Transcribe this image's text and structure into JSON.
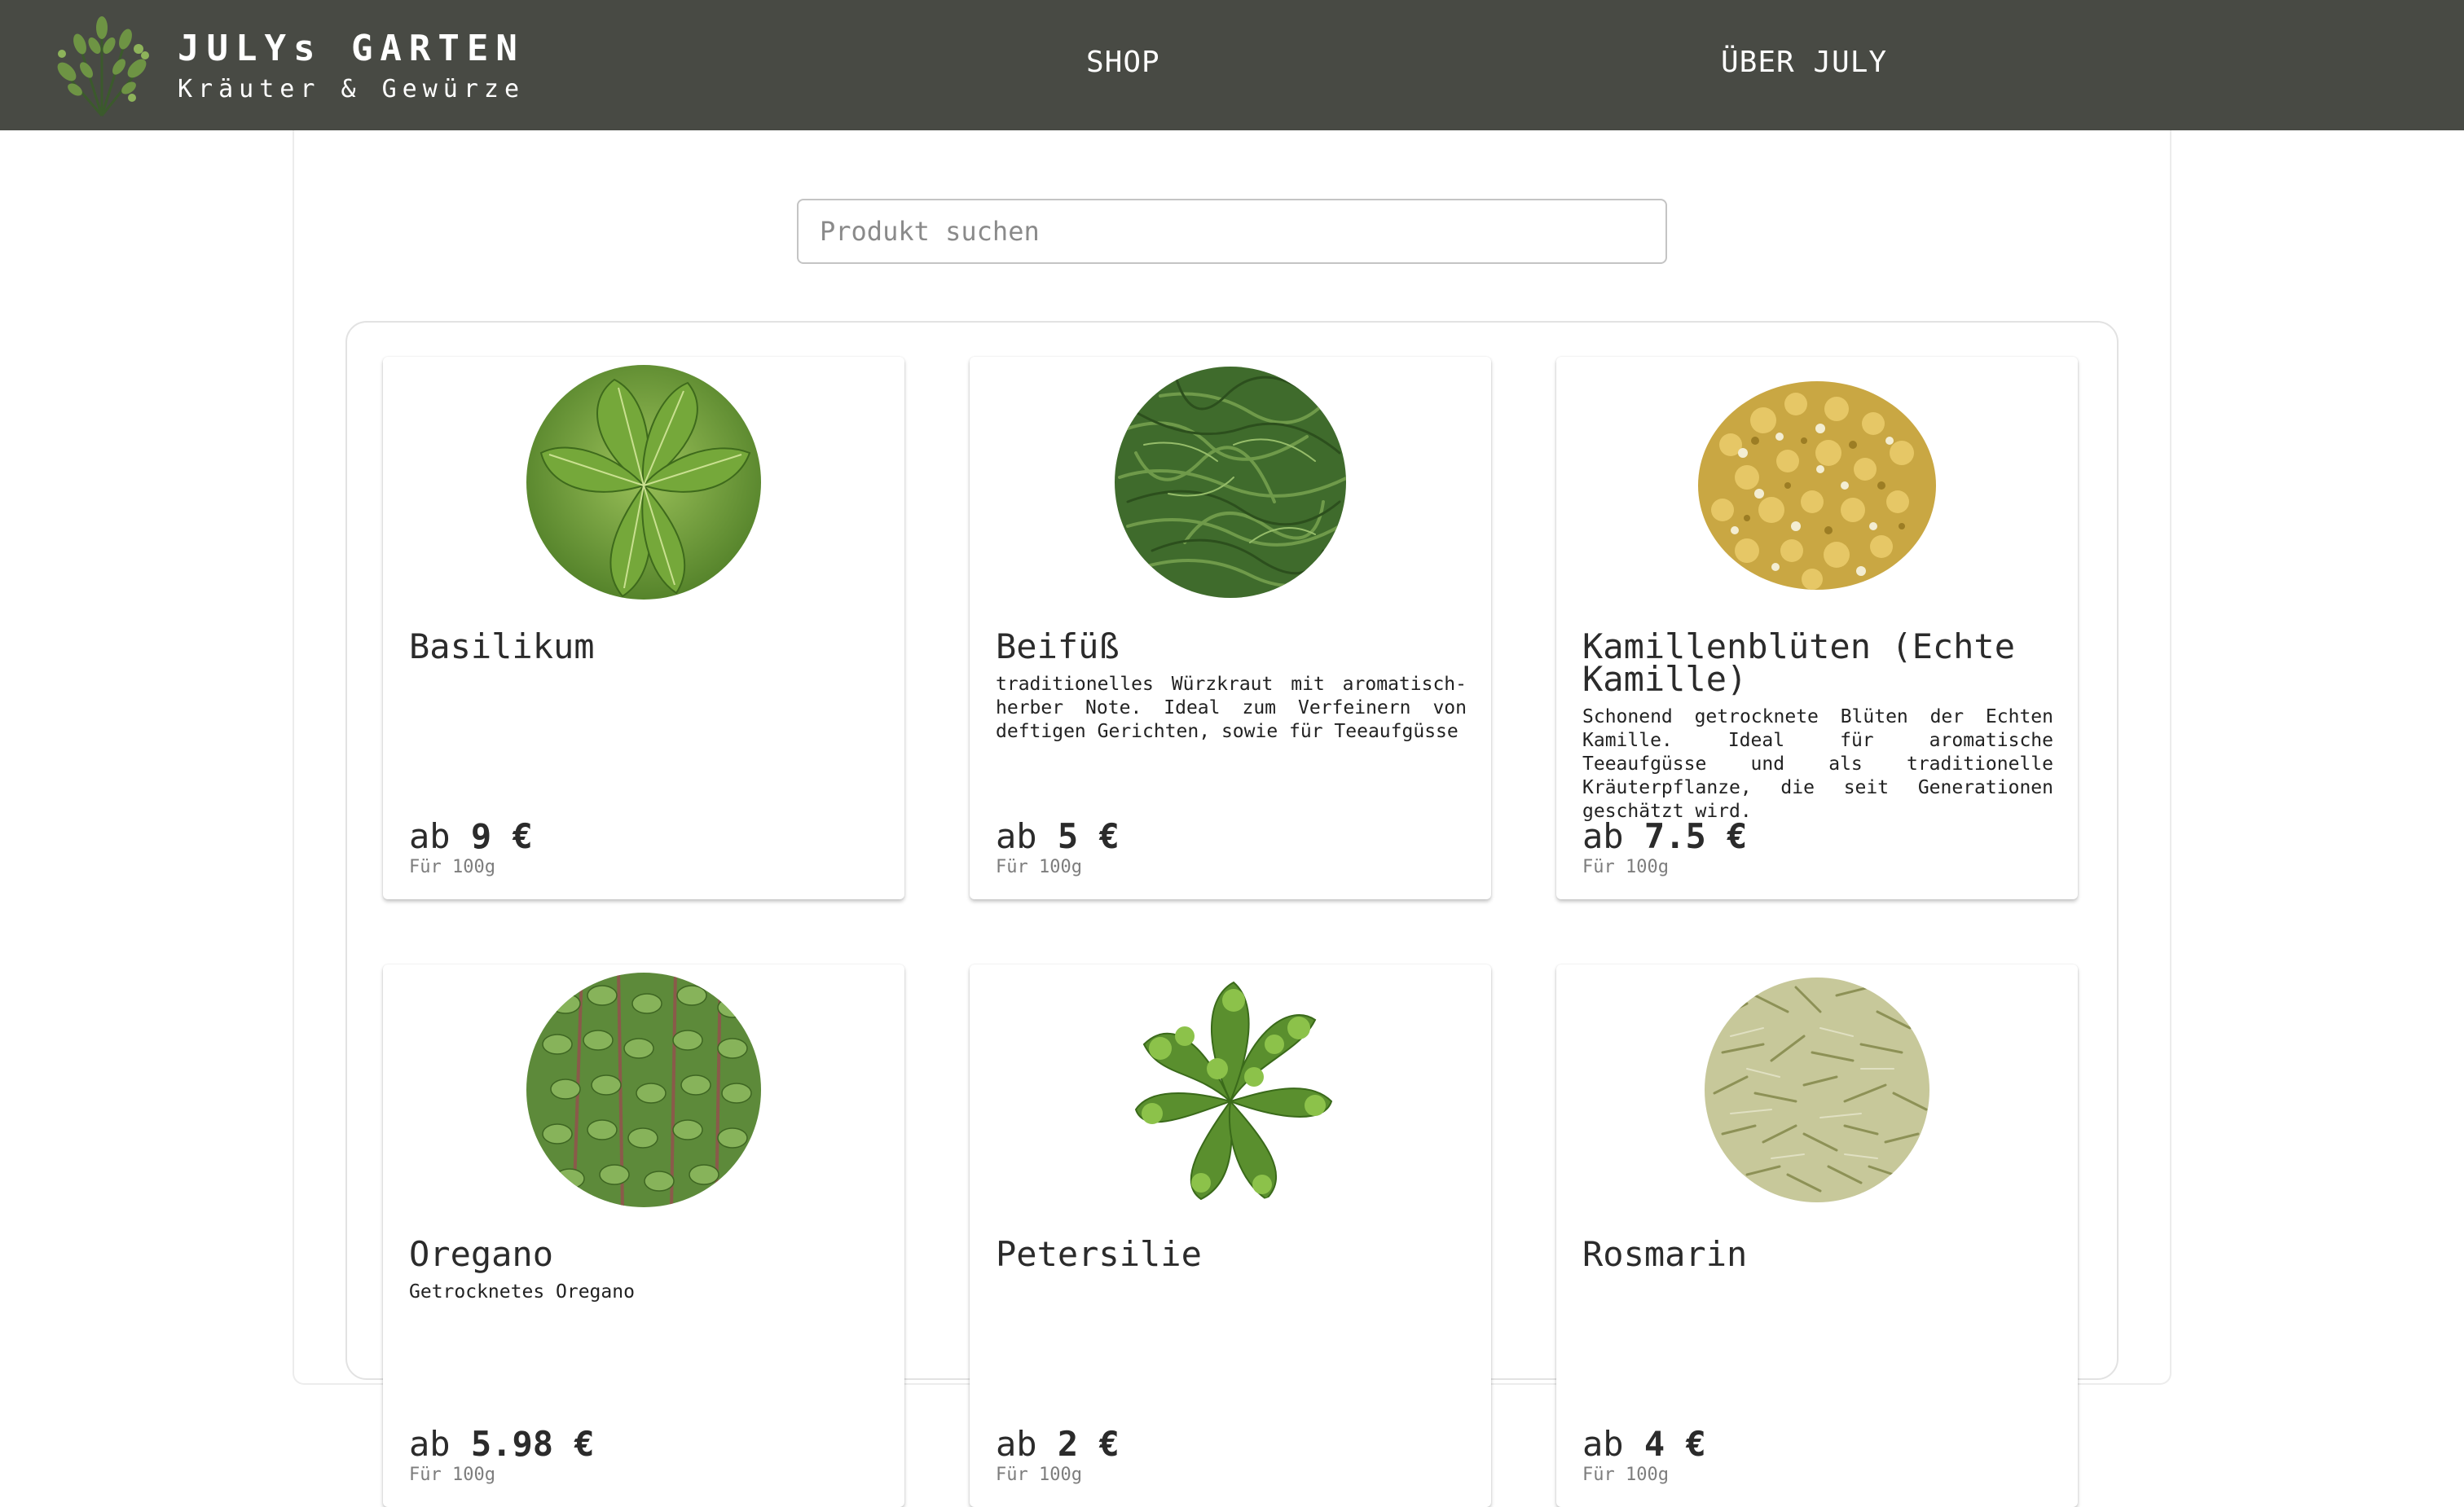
{
  "header": {
    "brand_title": "JULYs GARTEN",
    "brand_subtitle": "Kräuter & Gewürze",
    "nav": [
      {
        "label": "SHOP"
      },
      {
        "label": "ÜBER JULY"
      }
    ],
    "logo_icon": "herbs-logo-icon",
    "background_color": "#484a44"
  },
  "search": {
    "placeholder": "Produkt suchen",
    "value": ""
  },
  "products": [
    {
      "name": "Basilikum",
      "description": "",
      "price_prefix": "ab",
      "price": "9 €",
      "unit": "Für 100g",
      "image_icon": "basil-image"
    },
    {
      "name": "Beifüß",
      "description": "traditionelles Würzkraut mit aromatisch-herber Note. Ideal zum Verfeinern von deftigen Gerichten, sowie für Teeaufgüsse",
      "price_prefix": "ab",
      "price": "5 €",
      "unit": "Für 100g",
      "image_icon": "mugwort-image"
    },
    {
      "name": "Kamillenblüten (Echte Kamille)",
      "description": "Schonend getrocknete Blüten der Echten Kamille. Ideal für aromatische Teeaufgüsse und als traditionelle Kräuterpflanze, die seit Generationen geschätzt wird.",
      "price_prefix": "ab",
      "price": "7.5 €",
      "unit": "Für 100g",
      "image_icon": "chamomile-image"
    },
    {
      "name": "Oregano",
      "description": "Getrocknetes Oregano",
      "price_prefix": "ab",
      "price": "5.98 €",
      "unit": "Für 100g",
      "image_icon": "oregano-image"
    },
    {
      "name": "Petersilie",
      "description": "",
      "price_prefix": "ab",
      "price": "2 €",
      "unit": "Für 100g",
      "image_icon": "parsley-image"
    },
    {
      "name": "Rosmarin",
      "description": "",
      "price_prefix": "ab",
      "price": "4 €",
      "unit": "Für 100g",
      "image_icon": "rosemary-image"
    }
  ]
}
